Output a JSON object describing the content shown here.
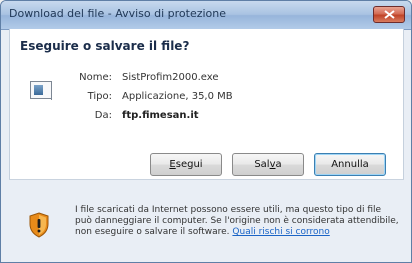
{
  "window": {
    "title": "Download del file - Avviso di protezione"
  },
  "dialog": {
    "heading": "Eseguire o salvare il file?",
    "fields": [
      {
        "label": "Nome:",
        "value": "SistProfim2000.exe"
      },
      {
        "label": "Tipo:",
        "value": "Applicazione, 35,0 MB"
      },
      {
        "label": "Da:",
        "value": "ftp.fimesan.it"
      }
    ]
  },
  "buttons": {
    "run_prefix": "",
    "run_access": "E",
    "run_rest": "segui",
    "save_prefix": "Sal",
    "save_access": "v",
    "save_rest": "a",
    "cancel_label": "Annulla"
  },
  "warning": {
    "text": "I file scaricati da Internet possono essere utili, ma questo tipo di file può danneggiare il computer. Se l'origine non è considerata attendibile, non eseguire o salvare il software.",
    "link": "Quali rischi si corrono"
  },
  "colors": {
    "link": "#1b64c6",
    "title_bar": "#a9c3e2",
    "close_button": "#c04428",
    "shield_orange": "#e88b1a"
  },
  "icons": {
    "file": "application-file-icon",
    "warning": "shield-warning-icon",
    "close": "close-icon"
  }
}
